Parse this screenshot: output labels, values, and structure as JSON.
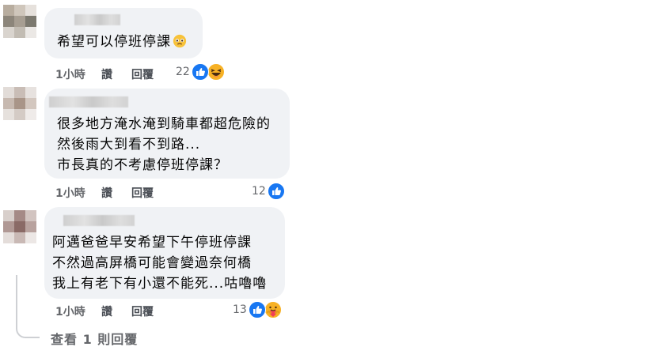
{
  "comments": [
    {
      "text": "希望可以停班停課",
      "actions": {
        "time": "1小時",
        "like": "讚",
        "reply": "回覆"
      },
      "reaction_count": "22",
      "reactions": [
        "like-icon",
        "haha-icon"
      ]
    },
    {
      "text": "很多地方淹水淹到騎車都超危險的\n然後雨大到看不到路...\n市長真的不考慮停班停課？",
      "actions": {
        "time": "1小時",
        "like": "讚",
        "reply": "回覆"
      },
      "reaction_count": "12",
      "reactions": [
        "like-icon"
      ]
    },
    {
      "text": "阿邁爸爸早安希望下午停班停課\n不然過高屏橋可能會變過奈何橋\n我上有老下有小還不能死...咕嚕嚕",
      "actions": {
        "time": "1小時",
        "like": "讚",
        "reply": "回覆"
      },
      "reaction_count": "13",
      "reactions": [
        "like-icon",
        "care-icon"
      ]
    }
  ],
  "view_replies": "查看 1 則回覆",
  "colors": {
    "bubble": "#f0f2f5",
    "like_blue": "#1877f2",
    "haha_yellow": "#f7b125",
    "meta_gray": "#65676b"
  }
}
